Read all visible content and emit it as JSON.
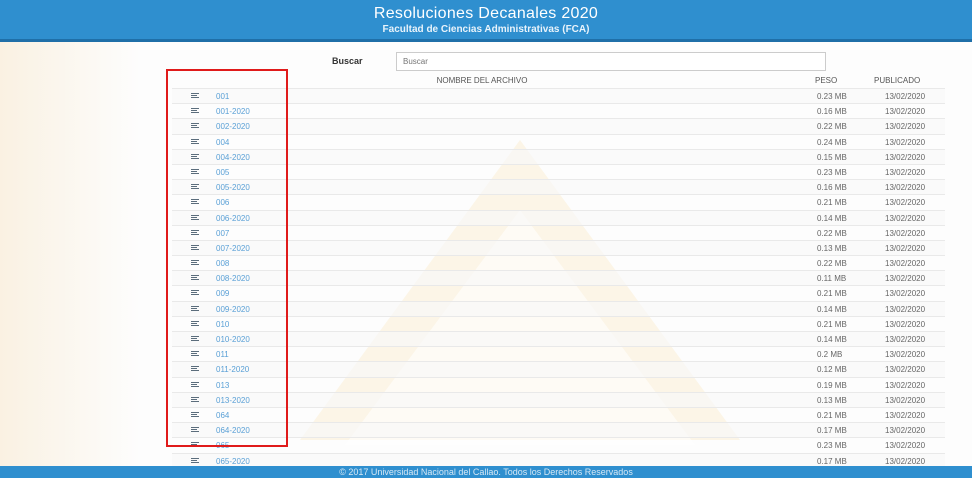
{
  "header": {
    "title": "Resoluciones Decanales 2020",
    "subtitle": "Facultad de Ciencias Administrativas (FCA)"
  },
  "search": {
    "label": "Buscar",
    "placeholder": "Buscar"
  },
  "table": {
    "columns": {
      "name": "NOMBRE DEL ARCHIVO",
      "size": "PESO",
      "date": "PUBLICADO"
    },
    "rows": [
      {
        "name": "001",
        "size": "0.23 MB",
        "date": "13/02/2020"
      },
      {
        "name": "001-2020",
        "size": "0.16 MB",
        "date": "13/02/2020"
      },
      {
        "name": "002-2020",
        "size": "0.22 MB",
        "date": "13/02/2020"
      },
      {
        "name": "004",
        "size": "0.24 MB",
        "date": "13/02/2020"
      },
      {
        "name": "004-2020",
        "size": "0.15 MB",
        "date": "13/02/2020"
      },
      {
        "name": "005",
        "size": "0.23 MB",
        "date": "13/02/2020"
      },
      {
        "name": "005-2020",
        "size": "0.16 MB",
        "date": "13/02/2020"
      },
      {
        "name": "006",
        "size": "0.21 MB",
        "date": "13/02/2020"
      },
      {
        "name": "006-2020",
        "size": "0.14 MB",
        "date": "13/02/2020"
      },
      {
        "name": "007",
        "size": "0.22 MB",
        "date": "13/02/2020"
      },
      {
        "name": "007-2020",
        "size": "0.13 MB",
        "date": "13/02/2020"
      },
      {
        "name": "008",
        "size": "0.22 MB",
        "date": "13/02/2020"
      },
      {
        "name": "008-2020",
        "size": "0.11 MB",
        "date": "13/02/2020"
      },
      {
        "name": "009",
        "size": "0.21 MB",
        "date": "13/02/2020"
      },
      {
        "name": "009-2020",
        "size": "0.14 MB",
        "date": "13/02/2020"
      },
      {
        "name": "010",
        "size": "0.21 MB",
        "date": "13/02/2020"
      },
      {
        "name": "010-2020",
        "size": "0.14 MB",
        "date": "13/02/2020"
      },
      {
        "name": "011",
        "size": "0.2 MB",
        "date": "13/02/2020"
      },
      {
        "name": "011-2020",
        "size": "0.12 MB",
        "date": "13/02/2020"
      },
      {
        "name": "013",
        "size": "0.19 MB",
        "date": "13/02/2020"
      },
      {
        "name": "013-2020",
        "size": "0.13 MB",
        "date": "13/02/2020"
      },
      {
        "name": "064",
        "size": "0.21 MB",
        "date": "13/02/2020"
      },
      {
        "name": "064-2020",
        "size": "0.17 MB",
        "date": "13/02/2020"
      },
      {
        "name": "065",
        "size": "0.23 MB",
        "date": "13/02/2020"
      },
      {
        "name": "065-2020",
        "size": "0.17 MB",
        "date": "13/02/2020"
      }
    ]
  },
  "footer": {
    "text": "© 2017 Universidad Nacional del Callao. Todos los Derechos Reservados"
  },
  "colors": {
    "header_bg": "#2f8fcf",
    "link": "#5aa0d6",
    "highlight_border": "#e01b1b"
  },
  "icons": {
    "file": "document-lines-icon"
  }
}
